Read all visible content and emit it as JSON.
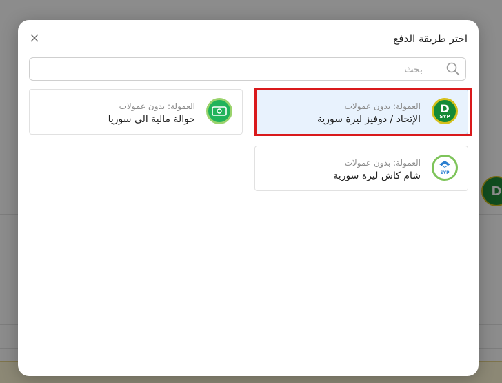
{
  "modal": {
    "title": "اختر طريقة الدفع",
    "close_symbol": "×"
  },
  "search": {
    "placeholder": "بحث",
    "value": ""
  },
  "methods": [
    {
      "name": "الإتحاد / دوفيز ليرة سورية",
      "commission": "العمولة: بدون عمولات",
      "logo_text": "D",
      "logo_subtext": "SYP",
      "selected": true
    },
    {
      "name": "حوالة مالية الى سوريا",
      "commission": "العمولة: بدون عمولات",
      "selected": false
    },
    {
      "name": "شام كاش ليرة سورية",
      "commission": "العمولة: بدون عمولات",
      "logo_subtext": "SYP",
      "selected": false
    }
  ],
  "colors": {
    "selected_bg": "#e8f2fd",
    "highlight_border": "#d9191c",
    "brand_green": "#148a36",
    "brand_gold": "#d6c01b"
  },
  "background": {
    "badge_text": "D"
  }
}
